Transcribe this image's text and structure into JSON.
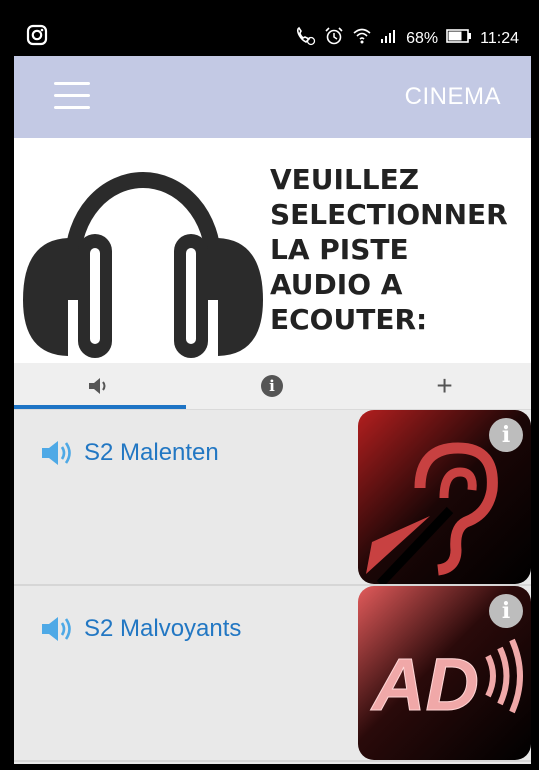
{
  "status_bar": {
    "battery": "68%",
    "time": "11:24",
    "icons": [
      "instagram-icon",
      "call-icon",
      "alarm-icon",
      "wifi-icon",
      "signal-icon",
      "battery-icon"
    ]
  },
  "app_bar": {
    "title": "CINEMA",
    "menu_icon": "hamburger-icon"
  },
  "hero": {
    "lines": [
      "VEUILLEZ",
      "SELECTIONNER",
      "LA PISTE",
      "AUDIO A",
      "ECOUTER:"
    ],
    "image": "headphones-icon"
  },
  "tabs": [
    {
      "icon": "speaker-icon",
      "active": true
    },
    {
      "icon": "info-icon",
      "active": false
    },
    {
      "icon": "plus-icon",
      "label": "+",
      "active": false
    }
  ],
  "tracks": [
    {
      "label": "S2 Malenten",
      "icon": "speaker-icon",
      "thumbnail": "hearing-assist-icon"
    },
    {
      "label": "S2 Malvoyants",
      "icon": "speaker-icon",
      "thumbnail": "audio-description-icon",
      "thumbnail_text": "AD"
    }
  ],
  "info_glyph": "i",
  "colors": {
    "app_bar": "#c3c9e4",
    "accent": "#1e74c5",
    "track_text": "#2277c3",
    "list_bg": "#e9e9e9"
  }
}
